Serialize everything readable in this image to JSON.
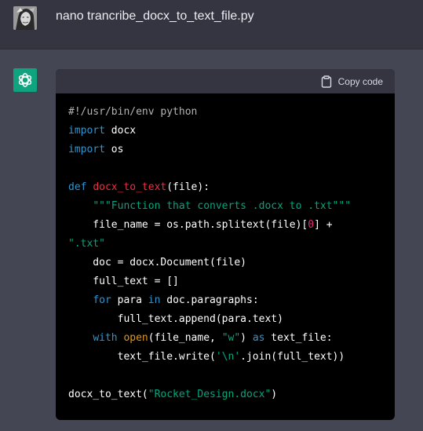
{
  "user_message": {
    "text": "nano trancribe_docx_to_text_file.py"
  },
  "assistant_message": {
    "copy_button_label": "Copy code",
    "code_lines": [
      [
        {
          "t": "#!/usr/bin/env python",
          "c": "comment"
        }
      ],
      [
        {
          "t": "import",
          "c": "keyword"
        },
        {
          "t": " docx",
          "c": "plain"
        }
      ],
      [
        {
          "t": "import",
          "c": "keyword"
        },
        {
          "t": " os",
          "c": "plain"
        }
      ],
      [],
      [
        {
          "t": "def",
          "c": "keyword"
        },
        {
          "t": " ",
          "c": "plain"
        },
        {
          "t": "docx_to_text",
          "c": "func"
        },
        {
          "t": "(file):",
          "c": "plain"
        }
      ],
      [
        {
          "t": "    ",
          "c": "plain"
        },
        {
          "t": "\"\"\"Function that converts .docx to .txt\"\"\"",
          "c": "string"
        }
      ],
      [
        {
          "t": "    file_name = os.path.splitext(file)[",
          "c": "plain"
        },
        {
          "t": "0",
          "c": "number"
        },
        {
          "t": "] +",
          "c": "plain"
        }
      ],
      [
        {
          "t": "\".txt\"",
          "c": "string"
        }
      ],
      [
        {
          "t": "    doc = docx.Document(file)",
          "c": "plain"
        }
      ],
      [
        {
          "t": "    full_text = []",
          "c": "plain"
        }
      ],
      [
        {
          "t": "    ",
          "c": "plain"
        },
        {
          "t": "for",
          "c": "keyword"
        },
        {
          "t": " para ",
          "c": "plain"
        },
        {
          "t": "in",
          "c": "keyword"
        },
        {
          "t": " doc.paragraphs:",
          "c": "plain"
        }
      ],
      [
        {
          "t": "        full_text.append(para.text)",
          "c": "plain"
        }
      ],
      [
        {
          "t": "    ",
          "c": "plain"
        },
        {
          "t": "with",
          "c": "keyword"
        },
        {
          "t": " ",
          "c": "plain"
        },
        {
          "t": "open",
          "c": "builtin"
        },
        {
          "t": "(file_name, ",
          "c": "plain"
        },
        {
          "t": "\"w\"",
          "c": "string"
        },
        {
          "t": ") ",
          "c": "plain"
        },
        {
          "t": "as",
          "c": "keyword"
        },
        {
          "t": " text_file:",
          "c": "plain"
        }
      ],
      [
        {
          "t": "        text_file.write(",
          "c": "plain"
        },
        {
          "t": "'\\n'",
          "c": "string"
        },
        {
          "t": ".join(full_text))",
          "c": "plain"
        }
      ],
      [],
      [
        {
          "t": "docx_to_text(",
          "c": "plain"
        },
        {
          "t": "\"Rocket_Design.docx\"",
          "c": "string"
        },
        {
          "t": ")",
          "c": "plain"
        }
      ]
    ]
  },
  "icons": {
    "user_avatar": "user-avatar-image",
    "assistant_avatar": "openai-logo-icon",
    "copy": "clipboard-icon"
  },
  "colors": {
    "page_background": "#444654",
    "user_row_background": "#343541",
    "code_background": "#000000",
    "code_header_background": "#343541",
    "assistant_avatar_background": "#10a37f"
  }
}
